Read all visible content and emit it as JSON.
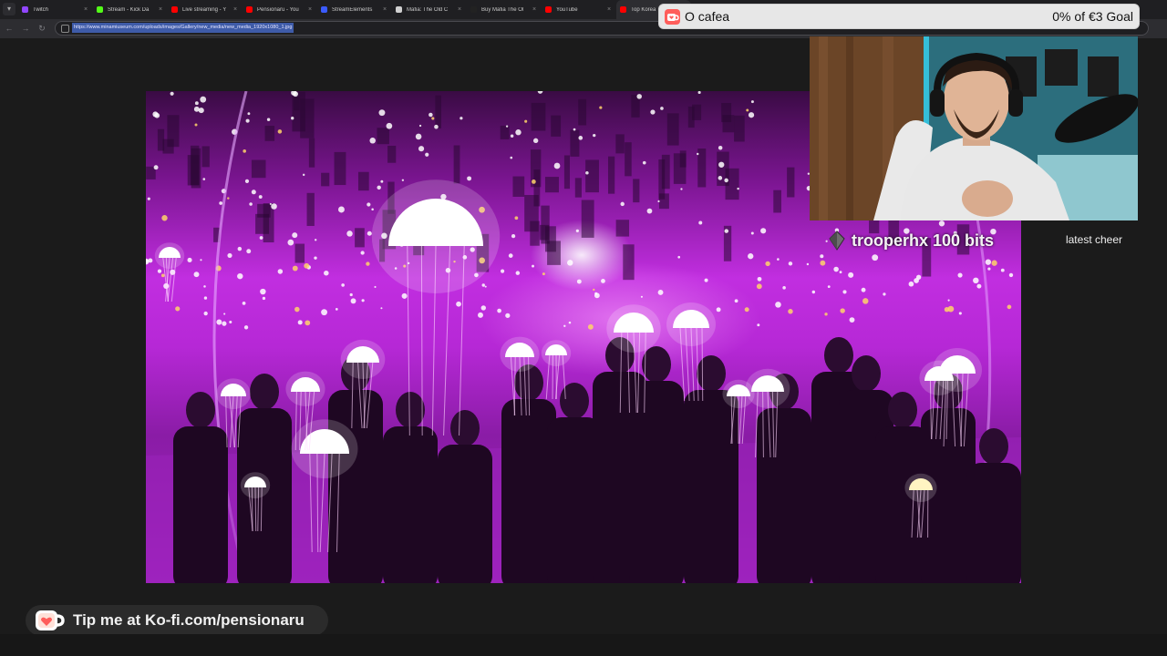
{
  "browser": {
    "tabs": [
      {
        "label": "Twitch",
        "favicon_color": "#9146ff",
        "active": false
      },
      {
        "label": "Stream - Kick Da",
        "favicon_color": "#53fc18",
        "active": false
      },
      {
        "label": "Live streaming - Y",
        "favicon_color": "#ff0000",
        "active": false
      },
      {
        "label": "Pensionaru - You",
        "favicon_color": "#ff0000",
        "active": false
      },
      {
        "label": "StreamElements",
        "favicon_color": "#3b5bfd",
        "active": false
      },
      {
        "label": "Mafia: The Old C",
        "favicon_color": "#d0d0d0",
        "active": false
      },
      {
        "label": "Buy Mafia The Ol",
        "favicon_color": "#222222",
        "active": false
      },
      {
        "label": "YouTube",
        "favicon_color": "#ff0000",
        "active": false
      },
      {
        "label": "Top Korea",
        "favicon_color": "#ff0000",
        "active": true
      }
    ],
    "url": "https://www.minamiuseum.com/uploads/images/Gallery/new_media/new_media_1920x1080_1.jpg"
  },
  "goal": {
    "title": "O cafea",
    "progress_text": "0% of €3 Goal",
    "progress": 0,
    "icon": "ko-fi-cup-icon",
    "accent": "#ff5e5b"
  },
  "cheer": {
    "label": "latest cheer",
    "text": "trooperhx 100 bits",
    "icon": "bits-gem-icon"
  },
  "kofi_banner": {
    "text": "Tip me at Ko-fi.com/pensionaru",
    "icon": "ko-fi-cup-icon",
    "accent": "#ff5e5b"
  },
  "image": {
    "subject": "jellyfish-lights-mirror-room-photo"
  }
}
